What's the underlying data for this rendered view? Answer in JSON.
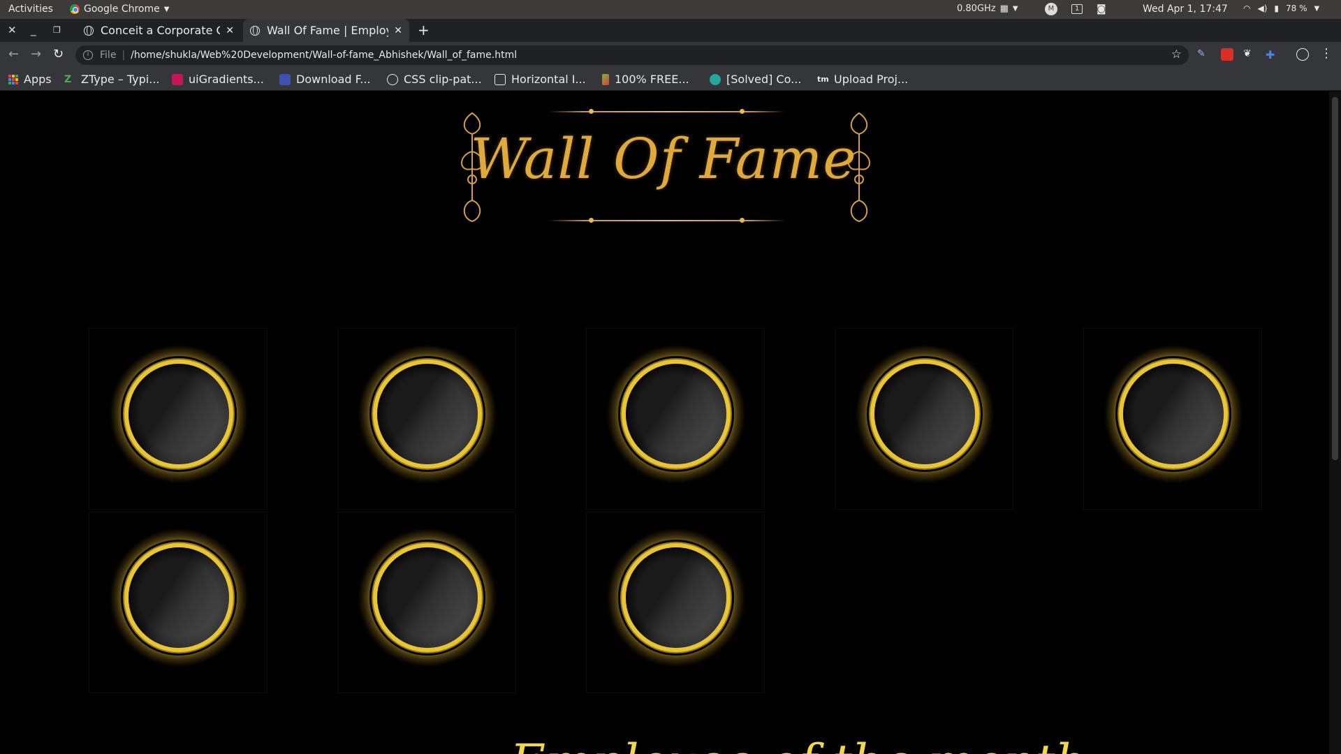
{
  "os_bar": {
    "activities": "Activities",
    "app_name": "Google Chrome",
    "cpu": "0.80GHz",
    "workspace": "1",
    "clock": "Wed Apr  1, 17:47",
    "battery": "78 %"
  },
  "tabs": [
    {
      "title": "Conceit a Corporate C",
      "active": false
    },
    {
      "title": "Wall Of Fame | Employ",
      "active": true
    }
  ],
  "address_bar": {
    "scheme": "File",
    "url": "/home/shukla/Web%20Development/Wall-of-fame_Abhishek/Wall_of_fame.html"
  },
  "bookmarks": [
    {
      "label": "Apps",
      "icon": "apps-grid-icon",
      "color": "#4285f4"
    },
    {
      "label": "ZType – Typi...",
      "icon": "ztype-icon",
      "color": "#4caf50"
    },
    {
      "label": "uiGradients...",
      "icon": "uigradients-icon",
      "color": "#c2185b"
    },
    {
      "label": "Download F...",
      "icon": "download-icon",
      "color": "#3f51b5"
    },
    {
      "label": "CSS clip-pat...",
      "icon": "clippath-icon",
      "color": "#e8eaed"
    },
    {
      "label": "Horizontal I...",
      "icon": "horizontal-icon",
      "color": "#e8eaed"
    },
    {
      "label": "100% FREE...",
      "icon": "free-icon",
      "color": "#7cb342"
    },
    {
      "label": "[Solved] Co...",
      "icon": "solved-icon",
      "color": "#26a69a"
    },
    {
      "label": "Upload Proj...",
      "icon": "upload-icon",
      "color": "#e8eaed"
    }
  ],
  "page": {
    "heading": "Wall Of Fame",
    "medal_count": 8,
    "subtitle": "Employee of the month"
  },
  "colors": {
    "gold": "#e0a93a",
    "ring_gold": "#e8c437",
    "background": "#000000"
  }
}
